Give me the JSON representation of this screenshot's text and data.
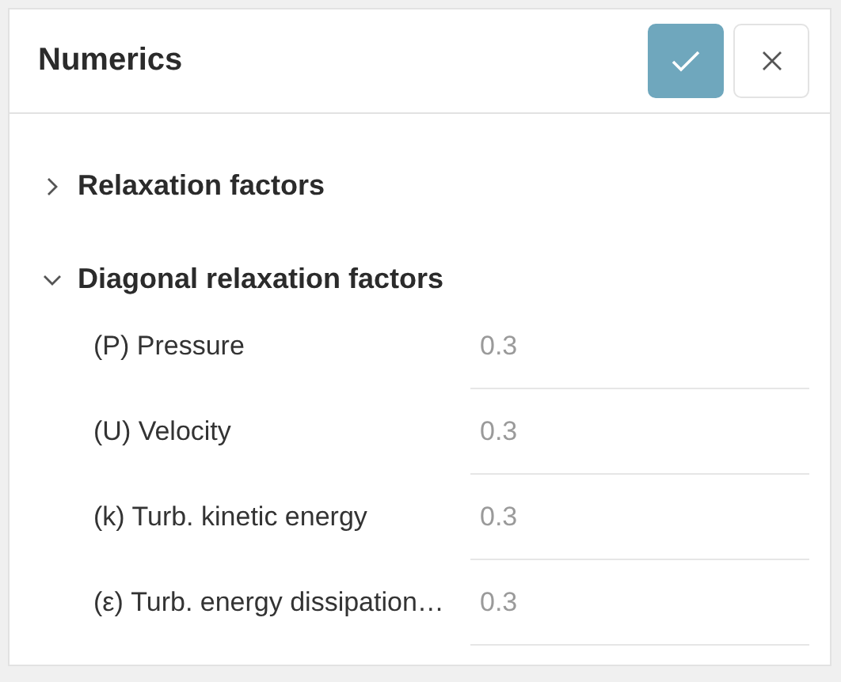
{
  "panel": {
    "title": "Numerics"
  },
  "sections": [
    {
      "title": "Relaxation factors",
      "expanded": false
    },
    {
      "title": "Diagonal relaxation factors",
      "expanded": true,
      "fields": [
        {
          "label": "(P) Pressure",
          "placeholder": "0.3"
        },
        {
          "label": "(U) Velocity",
          "placeholder": "0.3"
        },
        {
          "label": "(k) Turb. kinetic energy",
          "placeholder": "0.3"
        },
        {
          "label": "(ε) Turb. energy dissipation…",
          "placeholder": "0.3"
        }
      ]
    }
  ]
}
